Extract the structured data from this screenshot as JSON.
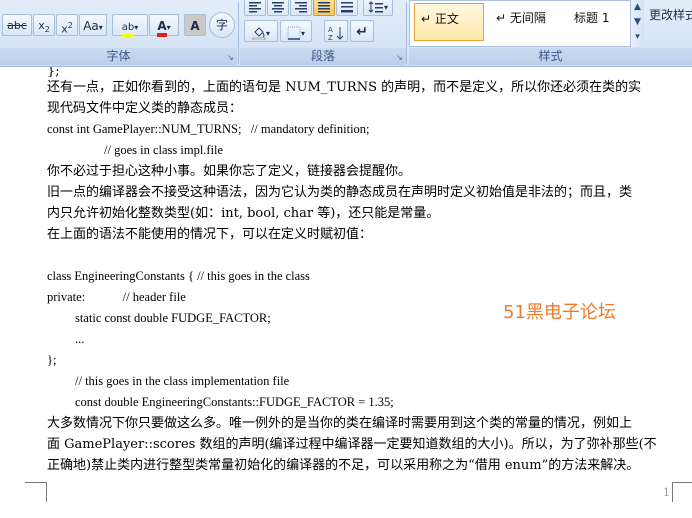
{
  "ribbon": {
    "font_group": {
      "label": "字体",
      "change_case_label": "Aa",
      "highlight_label": "ab",
      "font_color_label": "A",
      "char_shading_label": "A",
      "enclose_char_label": "字"
    },
    "paragraph_group": {
      "label": "段落"
    },
    "styles_group": {
      "label": "样式",
      "tiles": [
        "↵ 正文",
        "↵ 无间隔",
        "标题 1"
      ],
      "selected": "↵ 正文",
      "change_styles_label": "更改样式"
    },
    "colors": {
      "highlight": "#ffff00",
      "font_color": "#e02020",
      "accent": "#e3a53a"
    }
  },
  "document": {
    "lines": [
      "还有一点，正如你看到的，上面的语句是 NUM_TURNS 的声明，而不是定义，所以你还必须在类的实",
      "现代码文件中定义类的静态成员：",
      "const int GamePlayer::NUM_TURNS;   // mandatory definition;",
      "// goes in class impl.file",
      "你不必过于担心这种小事。如果你忘了定义，链接器会提醒你。",
      "旧一点的编译器会不接受这种语法，因为它认为类的静态成员在声明时定义初始值是非法的；而且，类",
      "内只允许初始化整数类型(如：int, bool, char 等)，还只能是常量。",
      "在上面的语法不能使用的情况下，可以在定义时赋初值：",
      "",
      "class EngineeringConstants { // this goes in the class",
      "private:            // header file",
      "static const double FUDGE_FACTOR;",
      "...",
      "};",
      "// this goes in the class implementation file",
      "const double EngineeringConstants::FUDGE_FACTOR = 1.35;",
      "大多数情况下你只要做这么多。唯一例外的是当你的类在编译时需要用到这个类的常量的情况，例如上",
      "面 GamePlayer::scores 数组的声明(编译过程中编译器一定要知道数组的大小)。所以，为了弥补那些(不",
      "正确地)禁止类内进行整型类常量初始化的编译器的不足，可以采用称之为“借用 enum”的方法来解决。"
    ],
    "watermark": "51黑电子论坛",
    "page_number": "1"
  }
}
